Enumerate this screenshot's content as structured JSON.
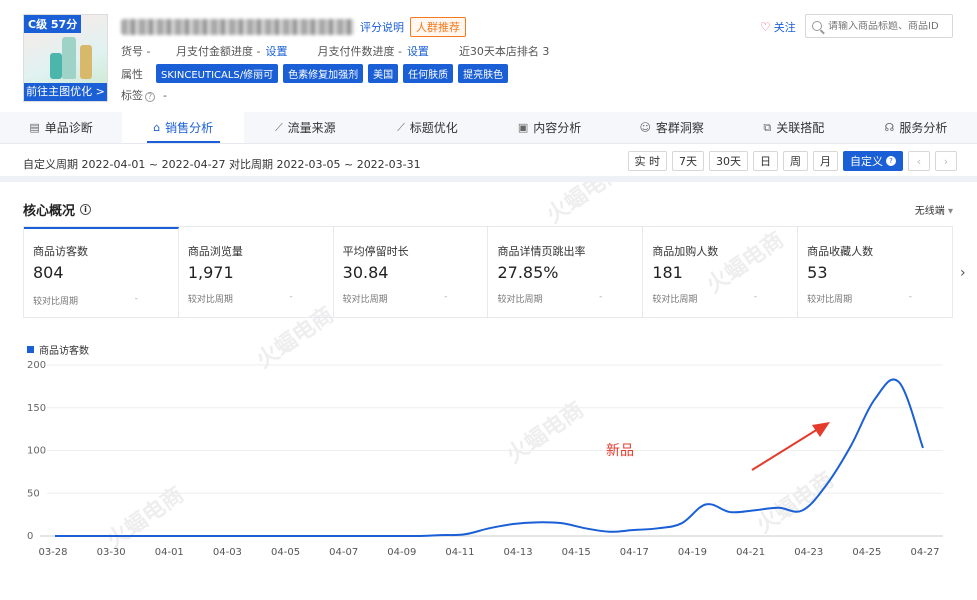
{
  "product": {
    "grade": "C级 57分",
    "optimize_button": "前往主图优化 >",
    "rating_link": "评分说明",
    "crowd_button": "人群推荐",
    "sku_label": "货号 -",
    "monthly_amount": "月支付金额进度 -",
    "monthly_amount_link": "设置",
    "monthly_count": "月支付件数进度 -",
    "monthly_count_link": "设置",
    "rank_30d": "近30天本店排名 3",
    "attr_label": "属性",
    "tags": [
      "SKINCEUTICALS/修丽可",
      "色素修复加强剂",
      "美国",
      "任何肤质",
      "提亮肤色"
    ],
    "label_label": "标签",
    "label_value": "-"
  },
  "header": {
    "follow_label": "关注",
    "search_placeholder": "请输入商品标题、商品ID"
  },
  "tabs": [
    {
      "label": "单品诊断",
      "icon": "▤"
    },
    {
      "label": "销售分析",
      "icon": "⌂"
    },
    {
      "label": "流量来源",
      "icon": "⟋"
    },
    {
      "label": "标题优化",
      "icon": "⟋"
    },
    {
      "label": "内容分析",
      "icon": "▣"
    },
    {
      "label": "客群洞察",
      "icon": "☺"
    },
    {
      "label": "关联搭配",
      "icon": "⧉"
    },
    {
      "label": "服务分析",
      "icon": "☊"
    }
  ],
  "period": {
    "text": "自定义周期 2022-04-01 ~ 2022-04-27 对比周期 2022-03-05 ~ 2022-03-31",
    "buttons": [
      "实 时",
      "7天",
      "30天",
      "日",
      "周",
      "月",
      "自定义"
    ],
    "active": "自定义"
  },
  "core": {
    "title": "核心概况",
    "device": "无线端",
    "compare_label": "较对比周期",
    "metrics": [
      {
        "name": "商品访客数",
        "value": "804",
        "cmp": "-"
      },
      {
        "name": "商品浏览量",
        "value": "1,971",
        "cmp": "-"
      },
      {
        "name": "平均停留时长",
        "value": "30.84",
        "cmp": "-"
      },
      {
        "name": "商品详情页跳出率",
        "value": "27.85%",
        "cmp": "-"
      },
      {
        "name": "商品加购人数",
        "value": "181",
        "cmp": "-"
      },
      {
        "name": "商品收藏人数",
        "value": "53",
        "cmp": "-"
      }
    ]
  },
  "annotation": "新品",
  "colors": {
    "accent": "#1a5fd6",
    "annotation": "#e53b2c"
  },
  "chart_data": {
    "type": "line",
    "series": [
      {
        "name": "商品访客数",
        "values": [
          0,
          0,
          0,
          0,
          0,
          0,
          0,
          0,
          0,
          0,
          0,
          0,
          0,
          0,
          0,
          0,
          1,
          2,
          9,
          14,
          16,
          15,
          9,
          5,
          7,
          9,
          15,
          37,
          28,
          30,
          33,
          30,
          60,
          105,
          160,
          180,
          103
        ]
      }
    ],
    "x_ticks": [
      "03-28",
      "03-30",
      "04-01",
      "04-03",
      "04-05",
      "04-07",
      "04-09",
      "04-11",
      "04-13",
      "04-15",
      "04-17",
      "04-19",
      "04-21",
      "04-23",
      "04-25",
      "04-27"
    ],
    "y_ticks": [
      "0",
      "50",
      "100",
      "150",
      "200"
    ],
    "ylim": [
      0,
      200
    ]
  }
}
